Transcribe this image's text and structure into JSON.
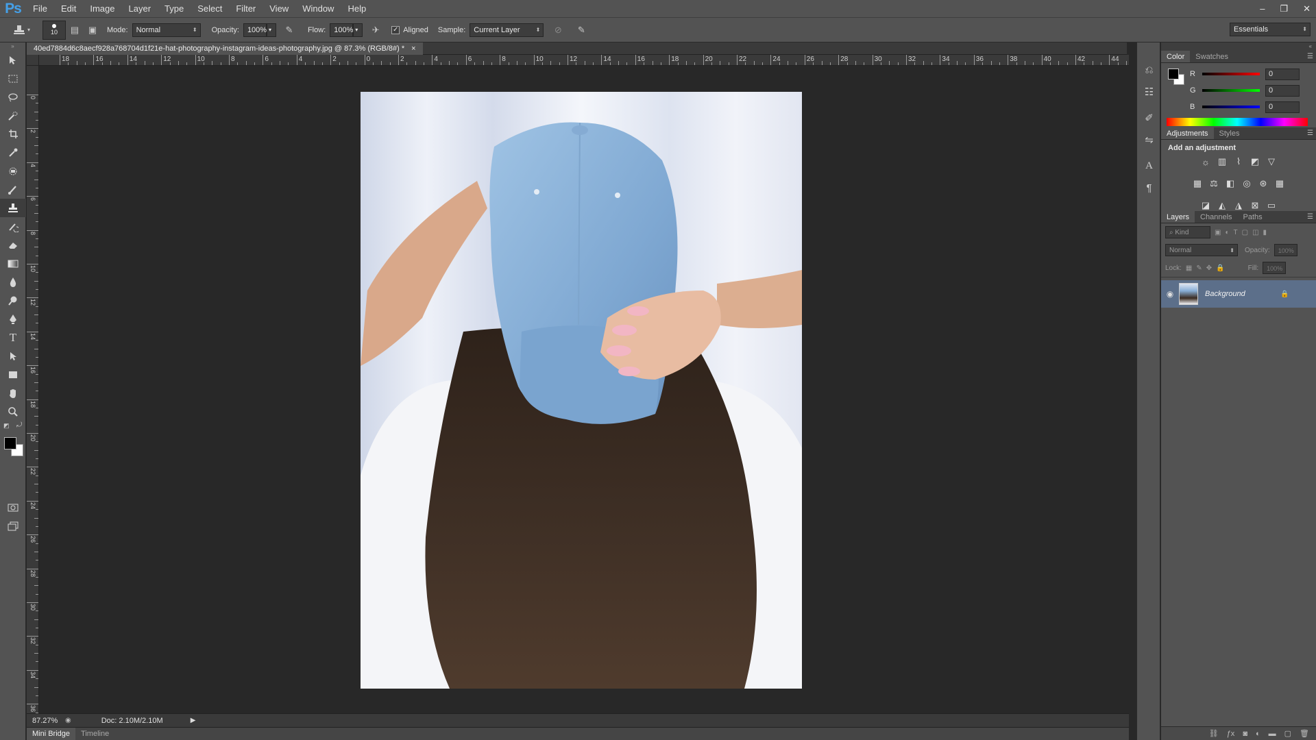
{
  "app": {
    "logo": "Ps"
  },
  "menu": [
    "File",
    "Edit",
    "Image",
    "Layer",
    "Type",
    "Select",
    "Filter",
    "View",
    "Window",
    "Help"
  ],
  "window_controls": {
    "minimize": "–",
    "restore": "❐",
    "close": "✕"
  },
  "options": {
    "brush_size": "10",
    "mode_label": "Mode:",
    "mode_value": "Normal",
    "opacity_label": "Opacity:",
    "opacity_value": "100%",
    "flow_label": "Flow:",
    "flow_value": "100%",
    "aligned_label": "Aligned",
    "aligned_checked": true,
    "sample_label": "Sample:",
    "sample_value": "Current Layer",
    "workspace": "Essentials"
  },
  "document": {
    "tab_title": "40ed7884d6c8aecf928a768704d1f21e-hat-photography-instagram-ideas-photography.jpg @ 87.3% (RGB/8#) *",
    "close": "×"
  },
  "ruler": {
    "top_labels": [
      "18",
      "16",
      "14",
      "12",
      "10",
      "8",
      "6",
      "4",
      "2",
      "0",
      "2",
      "4",
      "6",
      "8",
      "10",
      "12",
      "14",
      "16",
      "18",
      "20",
      "22",
      "24",
      "26",
      "28",
      "30",
      "32",
      "34",
      "36",
      "38",
      "40",
      "42",
      "44"
    ],
    "left_labels": [
      "0",
      "2",
      "4",
      "6",
      "8",
      "10",
      "12",
      "14",
      "16",
      "18",
      "20",
      "22",
      "24",
      "26",
      "28",
      "30",
      "32",
      "34",
      "36"
    ]
  },
  "status": {
    "zoom": "87.27%",
    "doc": "Doc: 2.10M/2.10M"
  },
  "bottom_tabs": [
    "Mini Bridge",
    "Timeline"
  ],
  "color_panel": {
    "tabs": [
      "Color",
      "Swatches"
    ],
    "channels": [
      {
        "label": "R",
        "value": "0",
        "color": "#e02020"
      },
      {
        "label": "G",
        "value": "0",
        "color": "#20c020"
      },
      {
        "label": "B",
        "value": "0",
        "color": "#2040e0"
      }
    ]
  },
  "adjustments_panel": {
    "tabs": [
      "Adjustments",
      "Styles"
    ],
    "heading": "Add an adjustment"
  },
  "layers_panel": {
    "tabs": [
      "Layers",
      "Channels",
      "Paths"
    ],
    "filter_kind": "Kind",
    "blend_mode": "Normal",
    "opacity_label": "Opacity:",
    "opacity_value": "100%",
    "lock_label": "Lock:",
    "fill_label": "Fill:",
    "fill_value": "100%",
    "layers": [
      {
        "name": "Background",
        "visible": true,
        "locked": true
      }
    ]
  },
  "colors": {
    "accent": "#45a0e8",
    "selected_layer": "#5c6f8a",
    "ui_bg": "#535353",
    "canvas_bg": "#282828"
  }
}
